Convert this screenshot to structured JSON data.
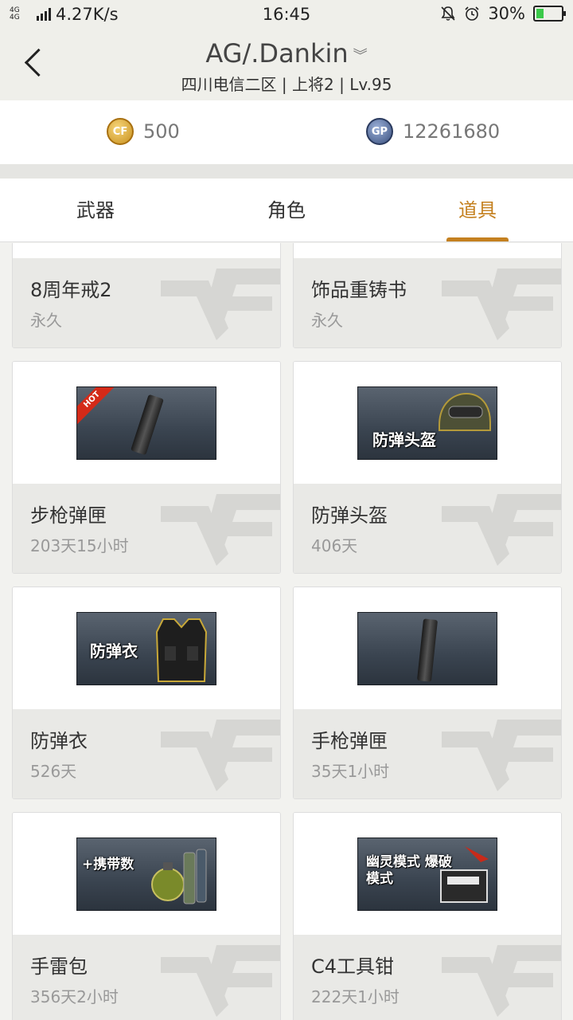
{
  "status": {
    "network": "4G 4G",
    "speed": "4.27K/s",
    "time": "16:45",
    "battery": "30%",
    "battery_level": 0.3,
    "icons": [
      "mute-icon",
      "alarm-icon"
    ]
  },
  "header": {
    "title": "AG/.Dankin",
    "subtitle": "四川电信二区 | 上将2 | Lv.95"
  },
  "currency": {
    "cf": {
      "icon_text": "CF",
      "value": "500"
    },
    "gp": {
      "icon_text": "GP",
      "value": "12261680"
    }
  },
  "tabs": [
    {
      "label": "武器",
      "active": false
    },
    {
      "label": "角色",
      "active": false
    },
    {
      "label": "道具",
      "active": true
    }
  ],
  "items": [
    {
      "name": "8周年戒2",
      "duration": "永久"
    },
    {
      "name": "饰品重铸书",
      "duration": "永久"
    },
    {
      "name": "步枪弹匣",
      "duration": "203天15小时",
      "hot": "HOT"
    },
    {
      "name": "防弹头盔",
      "duration": "406天",
      "thumb_label": "防弹头盔"
    },
    {
      "name": "防弹衣",
      "duration": "526天",
      "thumb_label": "防弹衣"
    },
    {
      "name": "手枪弹匣",
      "duration": "35天1小时"
    },
    {
      "name": "手雷包",
      "duration": "356天2小时",
      "thumb_label": "+携带数"
    },
    {
      "name": "C4工具钳",
      "duration": "222天1小时",
      "thumb_label": "幽灵模式 爆破模式"
    }
  ],
  "colors": {
    "accent": "#c4801f",
    "card_info_bg": "#e9e9e6"
  }
}
